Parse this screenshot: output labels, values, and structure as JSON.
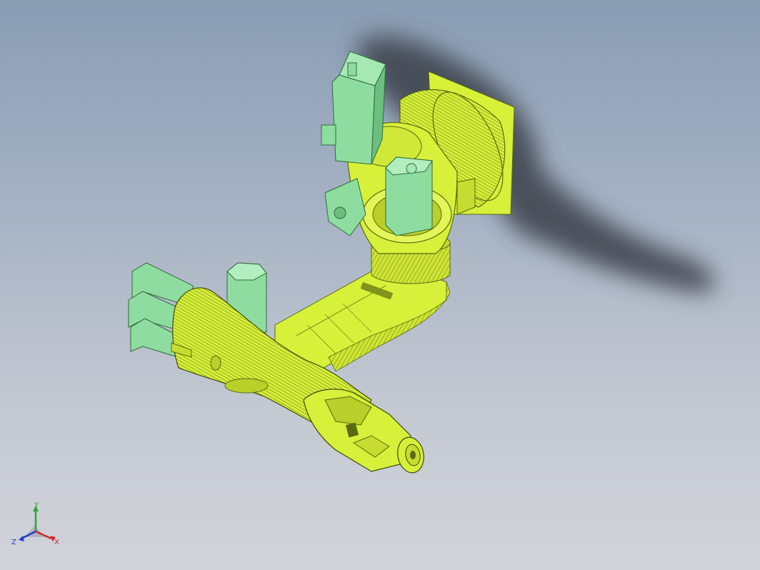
{
  "viewport": {
    "model": "robot-arm-assembly",
    "colors": {
      "part_body": "#d7f03a",
      "part_body_dark": "#8aa018",
      "part_motor": "#8fdca0",
      "part_motor_dark": "#5aa86a",
      "shadow": "#3a3f48"
    }
  },
  "triad": {
    "x_label": "X",
    "y_label": "Y",
    "z_label": "Z",
    "colors": {
      "x": "#d02a2a",
      "y": "#2aa82a",
      "z": "#2a3ad0"
    }
  }
}
